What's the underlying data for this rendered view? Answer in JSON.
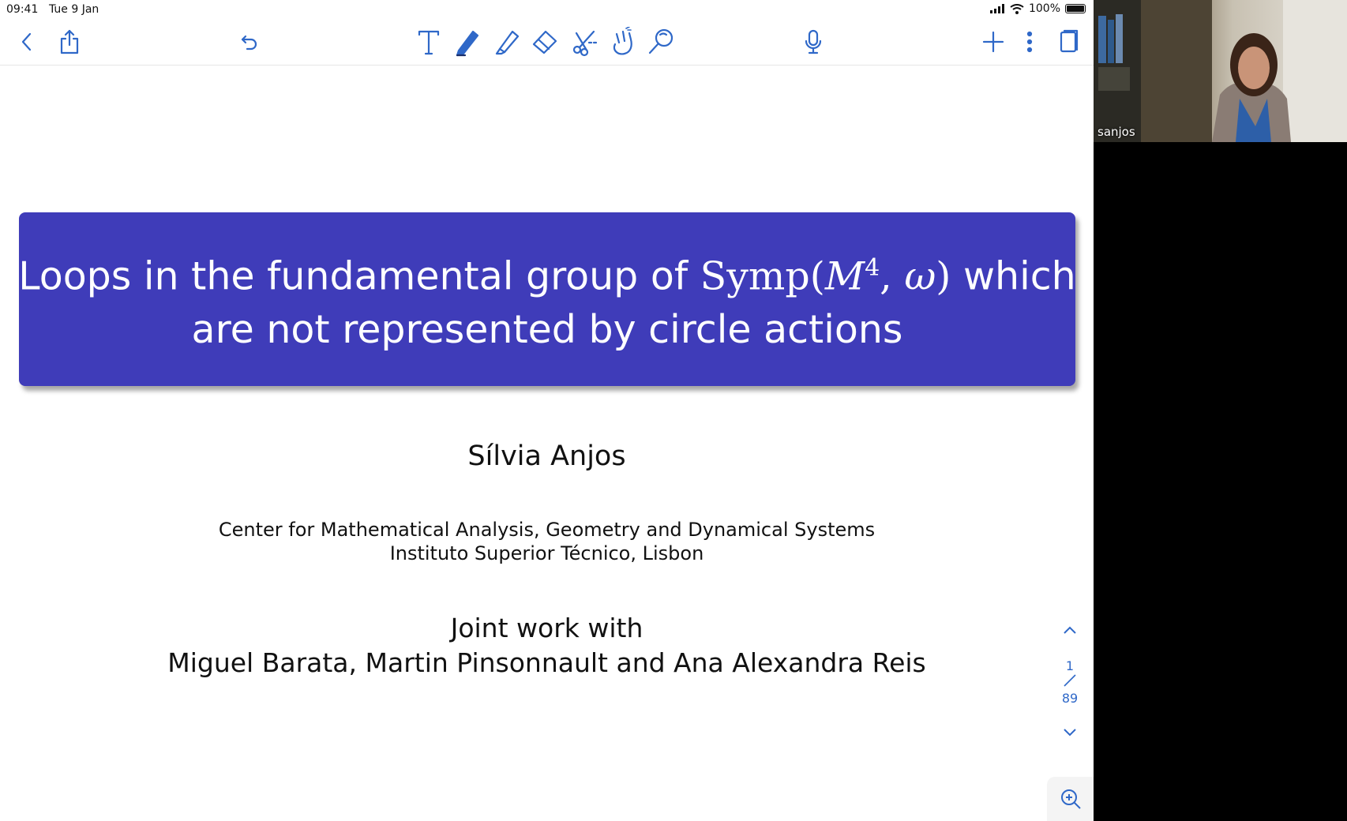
{
  "status_bar": {
    "time": "09:41",
    "date": "Tue 9 Jan",
    "battery": "100%"
  },
  "toolbar": {
    "icons": [
      "back-icon",
      "share-icon",
      "undo-icon",
      "text-tool-icon",
      "pen-icon",
      "highlighter-icon",
      "eraser-icon",
      "lasso-scissors-icon",
      "hand-icon",
      "magnifier-icon",
      "microphone-icon",
      "add-icon",
      "more-icon",
      "page-view-icon"
    ]
  },
  "slide": {
    "title_part1": "Loops in the fundamental group of ",
    "title_symp": "Symp(",
    "title_M": "M",
    "title_exp": "4",
    "title_comma": ", ",
    "title_omega": "ω",
    "title_close": ") ",
    "title_which": "which",
    "title_line2": "are not represented by circle actions",
    "author": "Sílvia Anjos",
    "affiliation_line1": "Center for Mathematical Analysis, Geometry and Dynamical Systems",
    "affiliation_line2": "Instituto Superior Técnico, Lisbon",
    "joint_line1": "Joint work with",
    "joint_line2": "Miguel Barata, Martin Pinsonnault and Ana Alexandra Reis"
  },
  "pager": {
    "current": "1",
    "total": "89"
  },
  "webcam": {
    "participant_name": "sanjos"
  },
  "colors": {
    "accent": "#2f68c8",
    "title_bg": "#3f3cb9"
  }
}
